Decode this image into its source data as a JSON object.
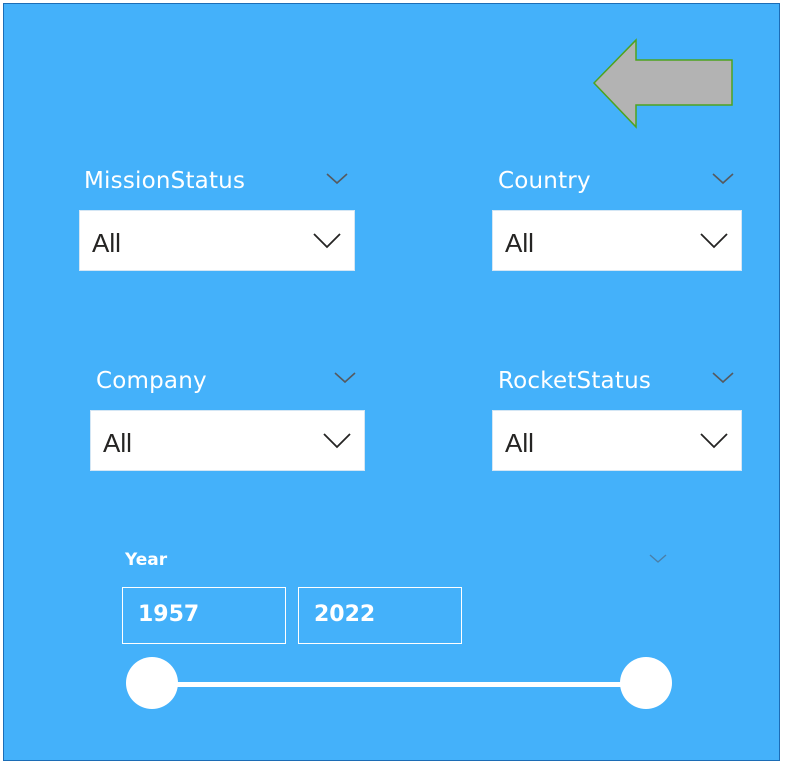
{
  "colors": {
    "panel_background": "#44b1fa",
    "arrow_fill": "#b3b3b3",
    "arrow_stroke": "#4ea31f",
    "dropdown_background": "#ffffff",
    "text_light": "#ffffff"
  },
  "icons": {
    "back": "left-arrow-icon",
    "menu": "chevron-down-icon"
  },
  "slicers": {
    "mission_status": {
      "title": "MissionStatus",
      "value": "All"
    },
    "country": {
      "title": "Country",
      "value": "All"
    },
    "company": {
      "title": "Company",
      "value": "All"
    },
    "rocket_status": {
      "title": "RocketStatus",
      "value": "All"
    }
  },
  "year_slicer": {
    "title": "Year",
    "start": "1957",
    "end": "2022"
  }
}
